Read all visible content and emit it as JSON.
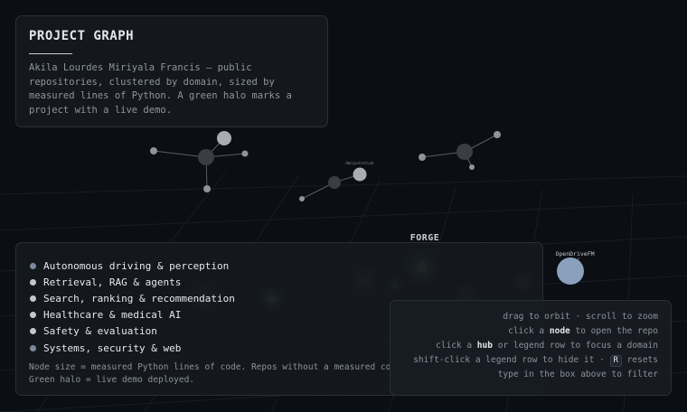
{
  "header": {
    "title": "PROJECT GRAPH",
    "description_lines": [
      "Akila Lourdes Miriyala Francis — public",
      "repositories, clustered by domain, sized by",
      "measured lines of Python. A green halo marks a",
      "project with a live demo."
    ]
  },
  "graph": {
    "hub_label": "FORGE",
    "node_labels": [
      "OpenDriveFM",
      "OmnipotentLab"
    ]
  },
  "legend": {
    "items": [
      {
        "label": "Autonomous driving & perception",
        "color": "#7c8aa0"
      },
      {
        "label": "Retrieval, RAG & agents",
        "color": "#c3c6cb"
      },
      {
        "label": "Search, ranking & recommendation",
        "color": "#c3c6cb"
      },
      {
        "label": "Healthcare & medical AI",
        "color": "#c3c6cb"
      },
      {
        "label": "Safety & evaluation",
        "color": "#c3c6cb"
      },
      {
        "label": "Systems, security & web",
        "color": "#7c8aa0"
      }
    ],
    "note_lines": [
      "Node size = measured Python lines of code. Repos without a measured co",
      "Green halo = live demo deployed."
    ]
  },
  "help": {
    "line1": "drag to orbit  ·  scroll to zoom",
    "line2_pre": "click a ",
    "line2_bold": "node",
    "line2_post": " to open the repo",
    "line3_pre": "click a ",
    "line3_bold": "hub",
    "line3_post": " or legend row to focus a domain",
    "line4_pre": "shift-click a legend row to hide it  ·  ",
    "line4_key": "R",
    "line4_post": " resets",
    "line5": "type in the box above to filter"
  },
  "colors": {
    "background": "#0b0e13",
    "panel": "#161a20",
    "node_light": "#a9adb3",
    "node_dark": "#3a3d43",
    "node_blue": "#8aa0bd",
    "demo_halo": "#4e8a5c"
  }
}
